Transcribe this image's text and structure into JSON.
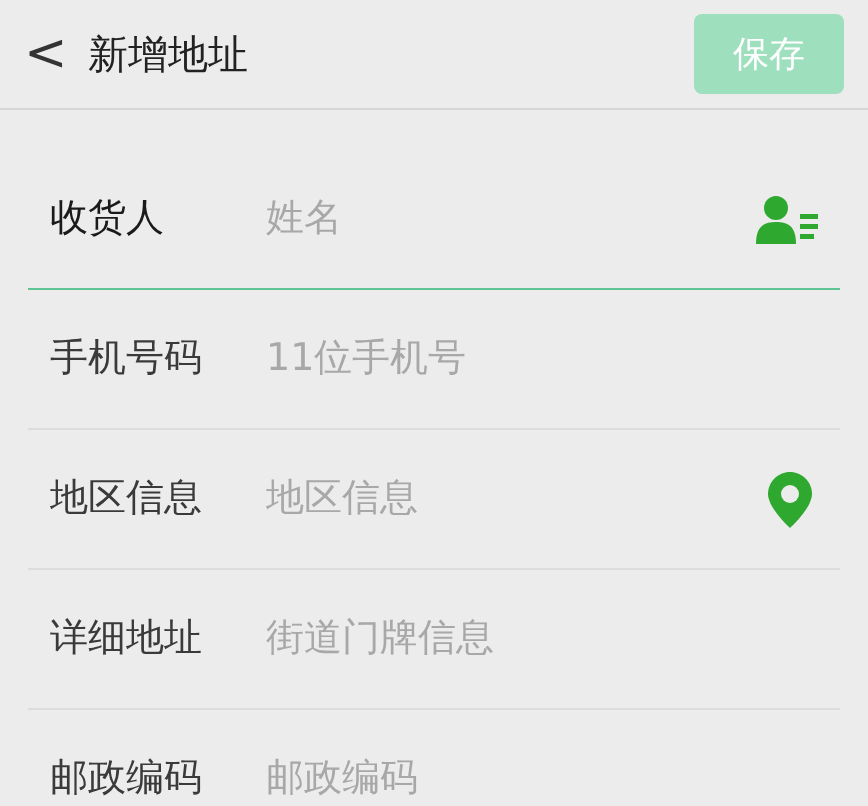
{
  "header": {
    "back_icon": "<",
    "title": "新增地址",
    "save_button": {
      "label": "保存",
      "disabled": true
    }
  },
  "fields": [
    {
      "label": "收货人",
      "placeholder": "姓名",
      "focused": true,
      "kind": "contact"
    },
    {
      "label": "手机号码",
      "placeholder": "11位手机号",
      "focused": false
    },
    {
      "label": "地区信息",
      "placeholder": "地区信息",
      "focused": false,
      "kind": "location"
    },
    {
      "label": "详细地址",
      "placeholder": "街道门牌信息",
      "focused": false
    },
    {
      "label": "邮政编码",
      "placeholder": "邮政编码",
      "focused": false
    }
  ]
}
